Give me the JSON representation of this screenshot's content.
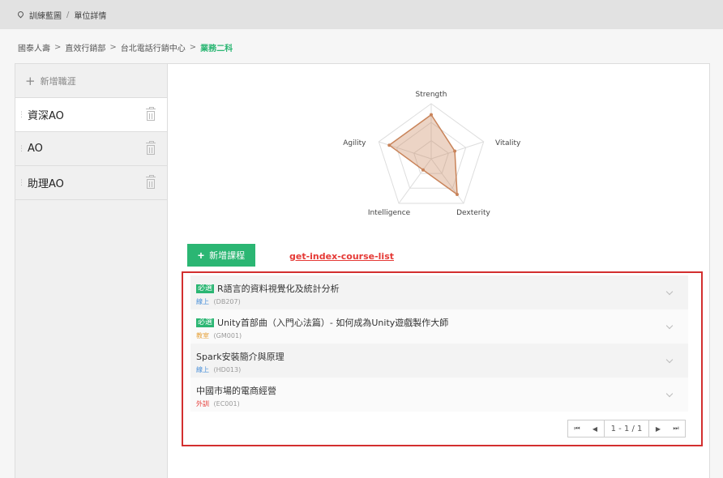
{
  "topbar": {
    "section": "訓練藍圖",
    "separator": "/",
    "page": "單位詳情"
  },
  "breadcrumb": {
    "items": [
      "國泰人壽",
      "直效行銷部",
      "台北電話行銷中心"
    ],
    "current": "業務二科",
    "arrow": ">"
  },
  "sidebar": {
    "add_label": "新增職涯",
    "roles": [
      {
        "label": "資深AO"
      },
      {
        "label": "AO"
      },
      {
        "label": "助理AO"
      }
    ]
  },
  "radar": {
    "labels": [
      "Strength",
      "Vitality",
      "Dexterity",
      "Intelligence",
      "Agility"
    ],
    "values": [
      0.8,
      0.45,
      0.8,
      0.25,
      0.8
    ],
    "color": "#c9845a"
  },
  "main": {
    "add_course_label": "新增課程",
    "annotation": "get-index-course-list"
  },
  "courses": [
    {
      "badge": "必選",
      "title": "R語言的資料視覺化及統計分析",
      "type": "線上",
      "type_color": "#4a90d9",
      "code": "(DB207)"
    },
    {
      "badge": "必選",
      "title": "Unity首部曲（入門心法篇）- 如何成為Unity遊戲製作大師",
      "type": "教室",
      "type_color": "#e6a23c",
      "code": "(GM001)"
    },
    {
      "badge": "",
      "title": "Spark安裝簡介與原理",
      "type": "線上",
      "type_color": "#4a90d9",
      "code": "(HD013)"
    },
    {
      "badge": "",
      "title": "中國市場的電商經營",
      "type": "外訓",
      "type_color": "#e53935",
      "code": "(EC001)"
    }
  ],
  "pager": {
    "info": "1 - 1 / 1"
  }
}
